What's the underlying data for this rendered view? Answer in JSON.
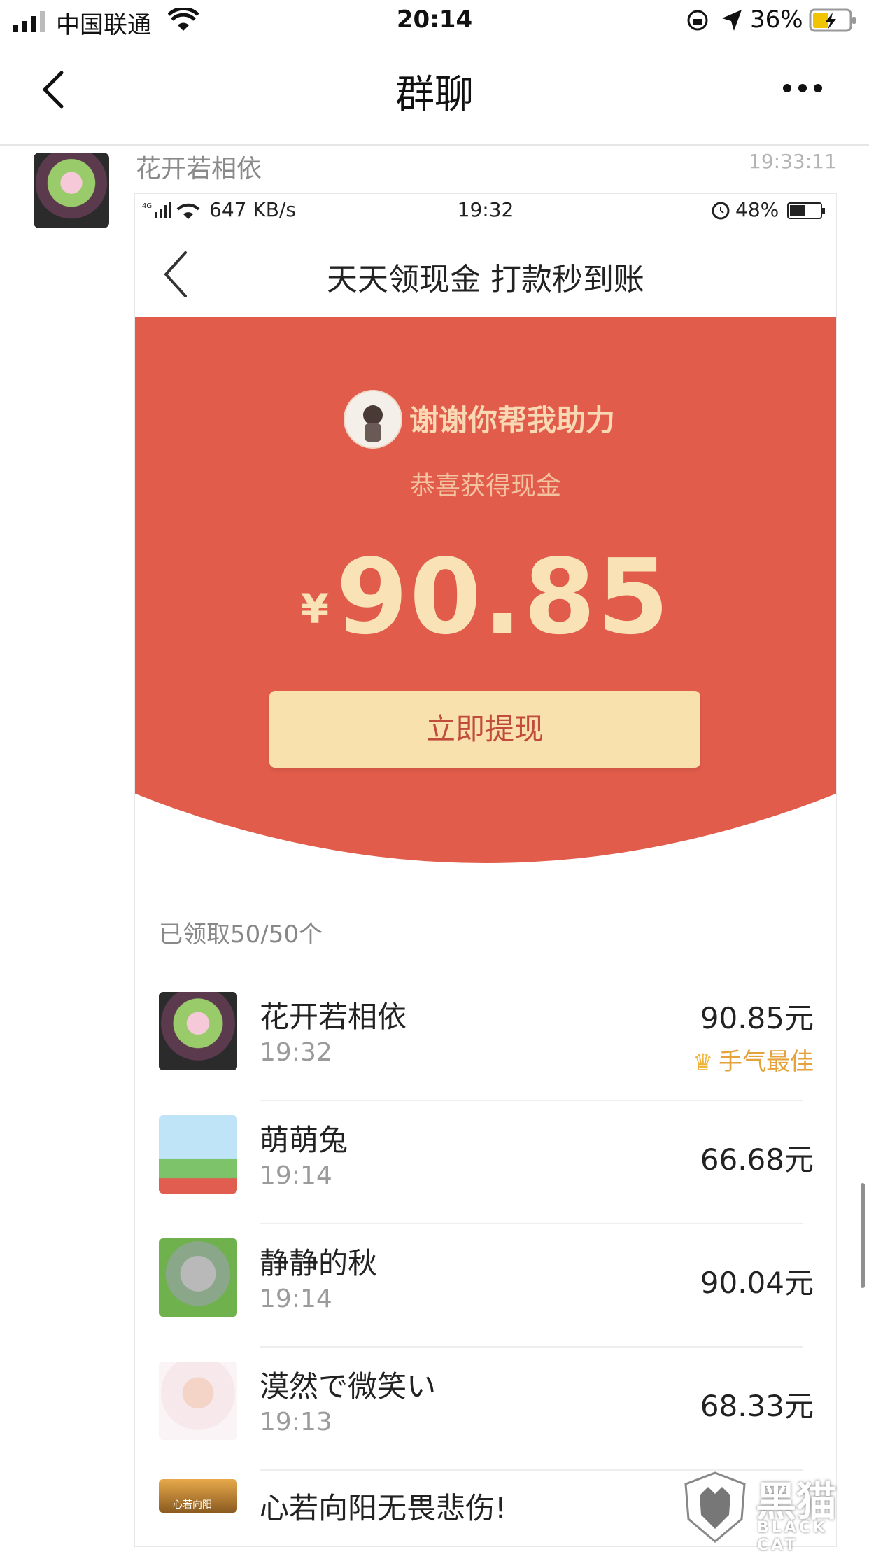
{
  "status_bar": {
    "carrier": "中国联通",
    "time": "20:14",
    "battery": "36%"
  },
  "nav": {
    "title": "群聊"
  },
  "message": {
    "sender": "花开若相依",
    "time": "19:33:11"
  },
  "screenshot": {
    "status": {
      "speed": "647 KB/s",
      "time": "19:32",
      "battery": "48%",
      "network": "4G"
    },
    "title": "天天领现金 打款秒到账",
    "thanks": "谢谢你帮我助力",
    "congrats": "恭喜获得现金",
    "currency": "¥",
    "amount": "90.85",
    "withdraw_label": "立即提现",
    "received_label": "已领取50/50个",
    "list": [
      {
        "name": "花开若相依",
        "time": "19:32",
        "amount": "90.85元",
        "badge": "手气最佳"
      },
      {
        "name": "萌萌兔",
        "time": "19:14",
        "amount": "66.68元"
      },
      {
        "name": "静静的秋",
        "time": "19:14",
        "amount": "90.04元"
      },
      {
        "name": "漠然で微笑い",
        "time": "19:13",
        "amount": "68.33元"
      },
      {
        "name": "心若向阳无畏悲伤!",
        "time": "",
        "amount": ""
      }
    ],
    "avatar_caption": "心若向阳"
  },
  "watermark": {
    "text": "黑猫",
    "subtext": "BLACK CAT"
  },
  "colors": {
    "red": "#e25c4b",
    "gold_button": "#f8e1ad",
    "amount_text": "#f8e2b6"
  }
}
